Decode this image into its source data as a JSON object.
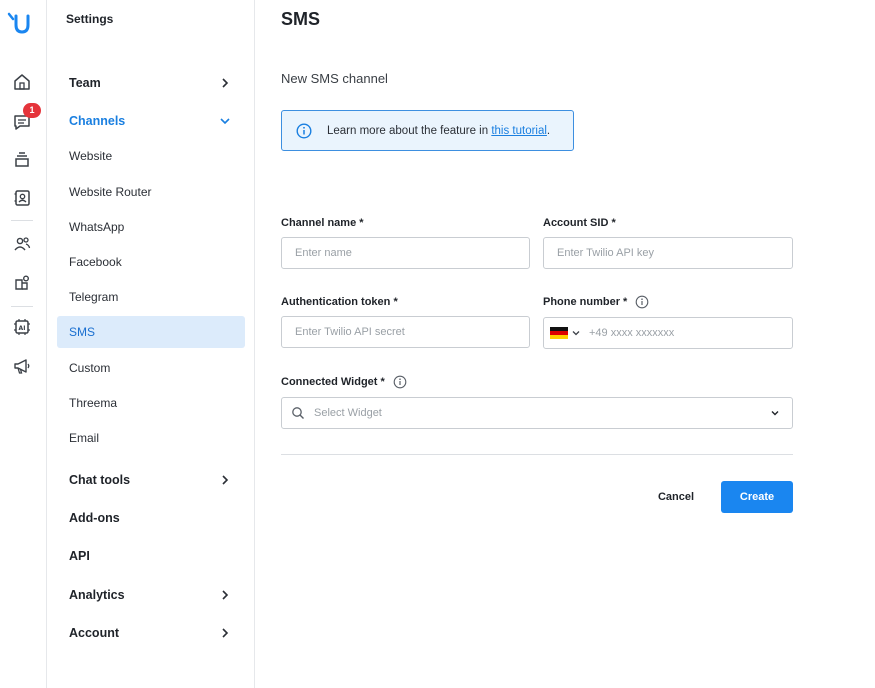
{
  "sidebar_rail": {
    "notification_count": "1",
    "icons": [
      "logo-icon",
      "home-icon",
      "chat-icon",
      "inbox-stack-icon",
      "contacts-icon",
      "people-icon",
      "integrations-icon",
      "ai-chip-icon",
      "megaphone-icon"
    ]
  },
  "settings_menu": {
    "title": "Settings",
    "items": [
      {
        "label": "Team"
      },
      {
        "label": "Channels"
      },
      {
        "label": "Website"
      },
      {
        "label": "Website Router"
      },
      {
        "label": "WhatsApp"
      },
      {
        "label": "Facebook"
      },
      {
        "label": "Telegram"
      },
      {
        "label": "SMS"
      },
      {
        "label": "Custom"
      },
      {
        "label": "Threema"
      },
      {
        "label": "Email"
      },
      {
        "label": "Chat tools"
      },
      {
        "label": "Add-ons"
      },
      {
        "label": "API"
      },
      {
        "label": "Analytics"
      },
      {
        "label": "Account"
      }
    ]
  },
  "main": {
    "title": "SMS",
    "subtitle": "New SMS channel",
    "info": {
      "text_before": "Learn more about the feature in ",
      "link_text": "this tutorial",
      "text_after": "."
    },
    "form": {
      "channel_name_label": "Channel name *",
      "channel_name_placeholder": "Enter name",
      "account_sid_label": "Account SID *",
      "account_sid_placeholder": "Enter Twilio API key",
      "auth_token_label": "Authentication token *",
      "auth_token_placeholder": "Enter Twilio API secret",
      "phone_label": "Phone number *",
      "phone_placeholder": "+49 xxxx xxxxxxx",
      "phone_country": "DE",
      "widget_label": "Connected Widget *",
      "widget_placeholder": "Select Widget"
    },
    "cancel_label": "Cancel",
    "create_label": "Create"
  },
  "colors": {
    "accent": "#1a86f0",
    "active_bg": "#dcebfb",
    "badge": "#e5343b"
  }
}
